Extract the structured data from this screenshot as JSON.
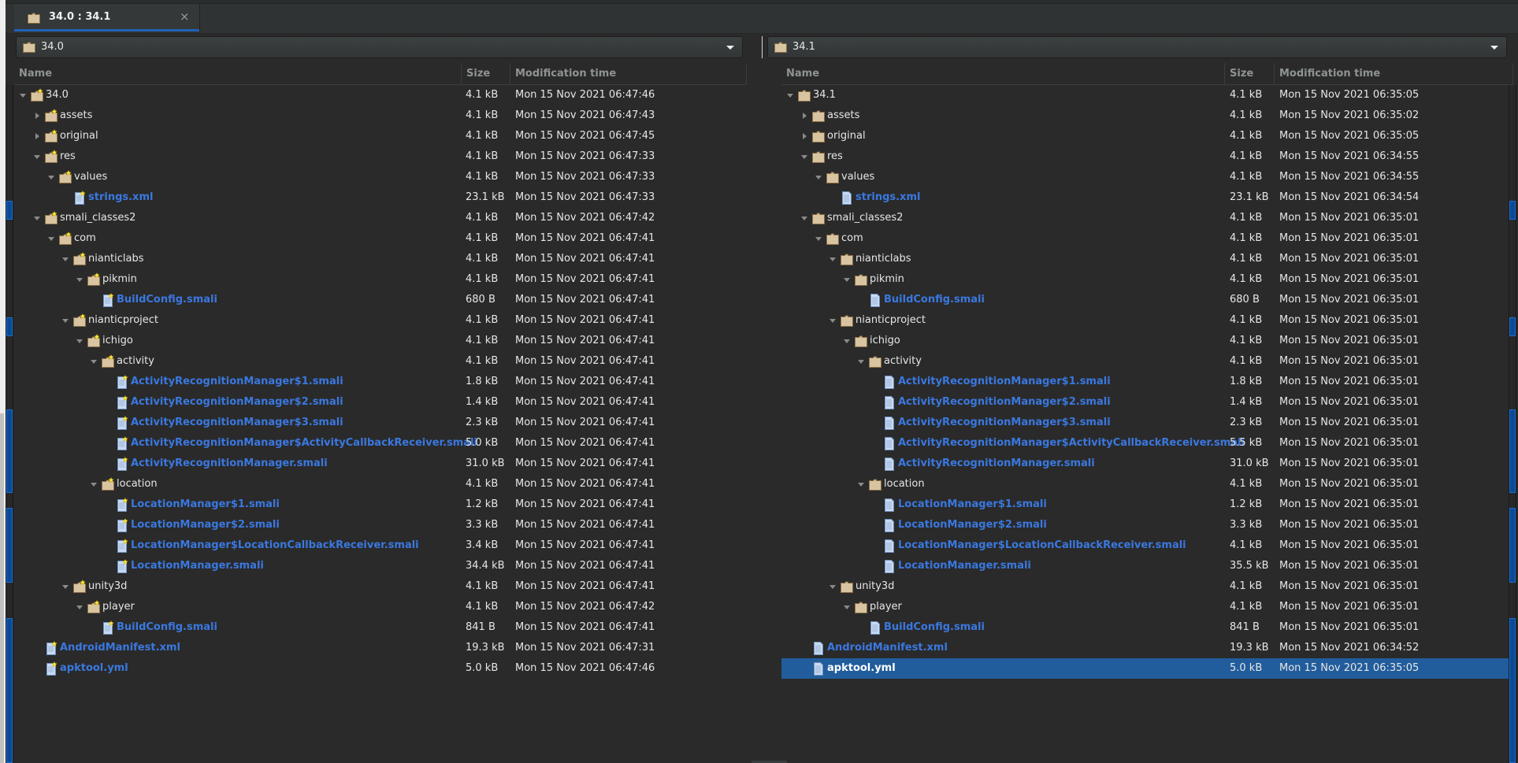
{
  "tab": {
    "label": "34.0 : 34.1",
    "icon": "folder-icon",
    "close": "×",
    "accent": "#1e63b8"
  },
  "columns": {
    "name": "Name",
    "size": "Size",
    "modified": "Modification time"
  },
  "colors": {
    "file_link": "#3a78e0",
    "selection": "#215d9c",
    "diff_marker": "#0a4a95"
  },
  "left": {
    "path": "34.0",
    "rows": [
      {
        "depth": 0,
        "type": "folder",
        "expander": "open",
        "name": "34.0",
        "size": "4.1 kB",
        "time": "Mon 15 Nov 2021 06:47:46"
      },
      {
        "depth": 1,
        "type": "folder",
        "expander": "closed",
        "name": "assets",
        "size": "4.1 kB",
        "time": "Mon 15 Nov 2021 06:47:43"
      },
      {
        "depth": 1,
        "type": "folder",
        "expander": "closed",
        "name": "original",
        "size": "4.1 kB",
        "time": "Mon 15 Nov 2021 06:47:45"
      },
      {
        "depth": 1,
        "type": "folder",
        "expander": "open",
        "name": "res",
        "size": "4.1 kB",
        "time": "Mon 15 Nov 2021 06:47:33"
      },
      {
        "depth": 2,
        "type": "folder",
        "expander": "open",
        "name": "values",
        "size": "4.1 kB",
        "time": "Mon 15 Nov 2021 06:47:33"
      },
      {
        "depth": 3,
        "type": "file",
        "expander": "none",
        "name": "strings.xml",
        "size": "23.1 kB",
        "time": "Mon 15 Nov 2021 06:47:33"
      },
      {
        "depth": 1,
        "type": "folder",
        "expander": "open",
        "name": "smali_classes2",
        "size": "4.1 kB",
        "time": "Mon 15 Nov 2021 06:47:42"
      },
      {
        "depth": 2,
        "type": "folder",
        "expander": "open",
        "name": "com",
        "size": "4.1 kB",
        "time": "Mon 15 Nov 2021 06:47:41"
      },
      {
        "depth": 3,
        "type": "folder",
        "expander": "open",
        "name": "nianticlabs",
        "size": "4.1 kB",
        "time": "Mon 15 Nov 2021 06:47:41"
      },
      {
        "depth": 4,
        "type": "folder",
        "expander": "open",
        "name": "pikmin",
        "size": "4.1 kB",
        "time": "Mon 15 Nov 2021 06:47:41"
      },
      {
        "depth": 5,
        "type": "file",
        "expander": "none",
        "name": "BuildConfig.smali",
        "size": "680 B",
        "time": "Mon 15 Nov 2021 06:47:41"
      },
      {
        "depth": 3,
        "type": "folder",
        "expander": "open",
        "name": "nianticproject",
        "size": "4.1 kB",
        "time": "Mon 15 Nov 2021 06:47:41"
      },
      {
        "depth": 4,
        "type": "folder",
        "expander": "open",
        "name": "ichigo",
        "size": "4.1 kB",
        "time": "Mon 15 Nov 2021 06:47:41"
      },
      {
        "depth": 5,
        "type": "folder",
        "expander": "open",
        "name": "activity",
        "size": "4.1 kB",
        "time": "Mon 15 Nov 2021 06:47:41"
      },
      {
        "depth": 6,
        "type": "file",
        "expander": "none",
        "name": "ActivityRecognitionManager$1.smali",
        "size": "1.8 kB",
        "time": "Mon 15 Nov 2021 06:47:41"
      },
      {
        "depth": 6,
        "type": "file",
        "expander": "none",
        "name": "ActivityRecognitionManager$2.smali",
        "size": "1.4 kB",
        "time": "Mon 15 Nov 2021 06:47:41"
      },
      {
        "depth": 6,
        "type": "file",
        "expander": "none",
        "name": "ActivityRecognitionManager$3.smali",
        "size": "2.3 kB",
        "time": "Mon 15 Nov 2021 06:47:41"
      },
      {
        "depth": 6,
        "type": "file",
        "expander": "none",
        "name": "ActivityRecognitionManager$ActivityCallbackReceiver.smali",
        "size": "5.0 kB",
        "time": "Mon 15 Nov 2021 06:47:41"
      },
      {
        "depth": 6,
        "type": "file",
        "expander": "none",
        "name": "ActivityRecognitionManager.smali",
        "size": "31.0 kB",
        "time": "Mon 15 Nov 2021 06:47:41"
      },
      {
        "depth": 5,
        "type": "folder",
        "expander": "open",
        "name": "location",
        "size": "4.1 kB",
        "time": "Mon 15 Nov 2021 06:47:41"
      },
      {
        "depth": 6,
        "type": "file",
        "expander": "none",
        "name": "LocationManager$1.smali",
        "size": "1.2 kB",
        "time": "Mon 15 Nov 2021 06:47:41"
      },
      {
        "depth": 6,
        "type": "file",
        "expander": "none",
        "name": "LocationManager$2.smali",
        "size": "3.3 kB",
        "time": "Mon 15 Nov 2021 06:47:41"
      },
      {
        "depth": 6,
        "type": "file",
        "expander": "none",
        "name": "LocationManager$LocationCallbackReceiver.smali",
        "size": "3.4 kB",
        "time": "Mon 15 Nov 2021 06:47:41"
      },
      {
        "depth": 6,
        "type": "file",
        "expander": "none",
        "name": "LocationManager.smali",
        "size": "34.4 kB",
        "time": "Mon 15 Nov 2021 06:47:41"
      },
      {
        "depth": 3,
        "type": "folder",
        "expander": "open",
        "name": "unity3d",
        "size": "4.1 kB",
        "time": "Mon 15 Nov 2021 06:47:41"
      },
      {
        "depth": 4,
        "type": "folder",
        "expander": "open",
        "name": "player",
        "size": "4.1 kB",
        "time": "Mon 15 Nov 2021 06:47:42"
      },
      {
        "depth": 5,
        "type": "file",
        "expander": "none",
        "name": "BuildConfig.smali",
        "size": "841 B",
        "time": "Mon 15 Nov 2021 06:47:41"
      },
      {
        "depth": 1,
        "type": "file",
        "expander": "none",
        "name": "AndroidManifest.xml",
        "size": "19.3 kB",
        "time": "Mon 15 Nov 2021 06:47:31"
      },
      {
        "depth": 1,
        "type": "file",
        "expander": "none",
        "name": "apktool.yml",
        "size": "5.0 kB",
        "time": "Mon 15 Nov 2021 06:47:46"
      }
    ]
  },
  "right": {
    "path": "34.1",
    "selected_index": 28,
    "rows": [
      {
        "depth": 0,
        "type": "folder",
        "expander": "open",
        "name": "34.1",
        "size": "4.1 kB",
        "time": "Mon 15 Nov 2021 06:35:05"
      },
      {
        "depth": 1,
        "type": "folder",
        "expander": "closed",
        "name": "assets",
        "size": "4.1 kB",
        "time": "Mon 15 Nov 2021 06:35:02"
      },
      {
        "depth": 1,
        "type": "folder",
        "expander": "closed",
        "name": "original",
        "size": "4.1 kB",
        "time": "Mon 15 Nov 2021 06:35:05"
      },
      {
        "depth": 1,
        "type": "folder",
        "expander": "open",
        "name": "res",
        "size": "4.1 kB",
        "time": "Mon 15 Nov 2021 06:34:55"
      },
      {
        "depth": 2,
        "type": "folder",
        "expander": "open",
        "name": "values",
        "size": "4.1 kB",
        "time": "Mon 15 Nov 2021 06:34:55"
      },
      {
        "depth": 3,
        "type": "file",
        "expander": "none",
        "name": "strings.xml",
        "size": "23.1 kB",
        "time": "Mon 15 Nov 2021 06:34:54"
      },
      {
        "depth": 1,
        "type": "folder",
        "expander": "open",
        "name": "smali_classes2",
        "size": "4.1 kB",
        "time": "Mon 15 Nov 2021 06:35:01"
      },
      {
        "depth": 2,
        "type": "folder",
        "expander": "open",
        "name": "com",
        "size": "4.1 kB",
        "time": "Mon 15 Nov 2021 06:35:01"
      },
      {
        "depth": 3,
        "type": "folder",
        "expander": "open",
        "name": "nianticlabs",
        "size": "4.1 kB",
        "time": "Mon 15 Nov 2021 06:35:01"
      },
      {
        "depth": 4,
        "type": "folder",
        "expander": "open",
        "name": "pikmin",
        "size": "4.1 kB",
        "time": "Mon 15 Nov 2021 06:35:01"
      },
      {
        "depth": 5,
        "type": "file",
        "expander": "none",
        "name": "BuildConfig.smali",
        "size": "680 B",
        "time": "Mon 15 Nov 2021 06:35:01"
      },
      {
        "depth": 3,
        "type": "folder",
        "expander": "open",
        "name": "nianticproject",
        "size": "4.1 kB",
        "time": "Mon 15 Nov 2021 06:35:01"
      },
      {
        "depth": 4,
        "type": "folder",
        "expander": "open",
        "name": "ichigo",
        "size": "4.1 kB",
        "time": "Mon 15 Nov 2021 06:35:01"
      },
      {
        "depth": 5,
        "type": "folder",
        "expander": "open",
        "name": "activity",
        "size": "4.1 kB",
        "time": "Mon 15 Nov 2021 06:35:01"
      },
      {
        "depth": 6,
        "type": "file",
        "expander": "none",
        "name": "ActivityRecognitionManager$1.smali",
        "size": "1.8 kB",
        "time": "Mon 15 Nov 2021 06:35:01"
      },
      {
        "depth": 6,
        "type": "file",
        "expander": "none",
        "name": "ActivityRecognitionManager$2.smali",
        "size": "1.4 kB",
        "time": "Mon 15 Nov 2021 06:35:01"
      },
      {
        "depth": 6,
        "type": "file",
        "expander": "none",
        "name": "ActivityRecognitionManager$3.smali",
        "size": "2.3 kB",
        "time": "Mon 15 Nov 2021 06:35:01"
      },
      {
        "depth": 6,
        "type": "file",
        "expander": "none",
        "name": "ActivityRecognitionManager$ActivityCallbackReceiver.smali",
        "size": "5.5 kB",
        "time": "Mon 15 Nov 2021 06:35:01"
      },
      {
        "depth": 6,
        "type": "file",
        "expander": "none",
        "name": "ActivityRecognitionManager.smali",
        "size": "31.0 kB",
        "time": "Mon 15 Nov 2021 06:35:01"
      },
      {
        "depth": 5,
        "type": "folder",
        "expander": "open",
        "name": "location",
        "size": "4.1 kB",
        "time": "Mon 15 Nov 2021 06:35:01"
      },
      {
        "depth": 6,
        "type": "file",
        "expander": "none",
        "name": "LocationManager$1.smali",
        "size": "1.2 kB",
        "time": "Mon 15 Nov 2021 06:35:01"
      },
      {
        "depth": 6,
        "type": "file",
        "expander": "none",
        "name": "LocationManager$2.smali",
        "size": "3.3 kB",
        "time": "Mon 15 Nov 2021 06:35:01"
      },
      {
        "depth": 6,
        "type": "file",
        "expander": "none",
        "name": "LocationManager$LocationCallbackReceiver.smali",
        "size": "4.1 kB",
        "time": "Mon 15 Nov 2021 06:35:01"
      },
      {
        "depth": 6,
        "type": "file",
        "expander": "none",
        "name": "LocationManager.smali",
        "size": "35.5 kB",
        "time": "Mon 15 Nov 2021 06:35:01"
      },
      {
        "depth": 3,
        "type": "folder",
        "expander": "open",
        "name": "unity3d",
        "size": "4.1 kB",
        "time": "Mon 15 Nov 2021 06:35:01"
      },
      {
        "depth": 4,
        "type": "folder",
        "expander": "open",
        "name": "player",
        "size": "4.1 kB",
        "time": "Mon 15 Nov 2021 06:35:01"
      },
      {
        "depth": 5,
        "type": "file",
        "expander": "none",
        "name": "BuildConfig.smali",
        "size": "841 B",
        "time": "Mon 15 Nov 2021 06:35:01"
      },
      {
        "depth": 1,
        "type": "file",
        "expander": "none",
        "name": "AndroidManifest.xml",
        "size": "19.3 kB",
        "time": "Mon 15 Nov 2021 06:34:52"
      },
      {
        "depth": 1,
        "type": "file",
        "expander": "none",
        "name": "apktool.yml",
        "size": "5.0 kB",
        "time": "Mon 15 Nov 2021 06:35:05"
      }
    ]
  }
}
